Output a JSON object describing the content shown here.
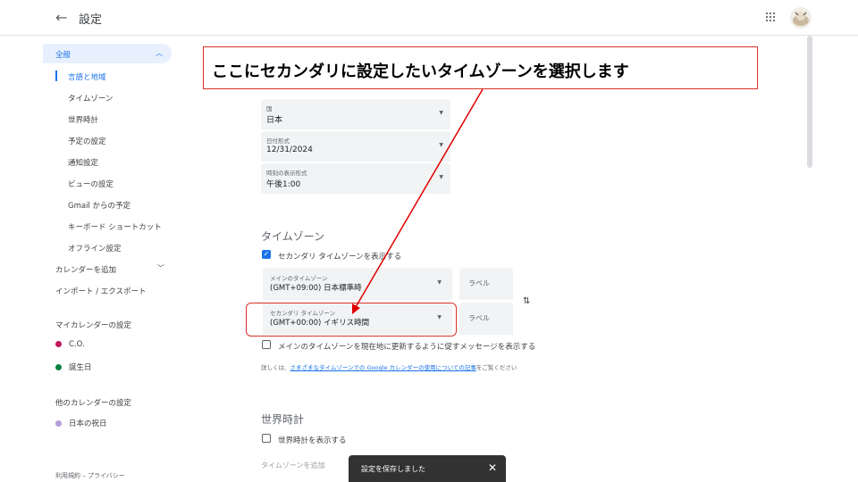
{
  "header": {
    "back_icon": "←",
    "title": "設定"
  },
  "sidebar": {
    "general": {
      "label": "全般",
      "chevron": "^"
    },
    "sub_items": [
      "言語と地域",
      "タイムゾーン",
      "世界時計",
      "予定の設定",
      "通知設定",
      "ビューの設定",
      "Gmail からの予定",
      "キーボード ショートカット",
      "オフライン設定"
    ],
    "add_calendar": "カレンダーを追加",
    "import_export": "インポート / エクスポート",
    "my_calendars_head": "マイカレンダーの設定",
    "my_calendars": [
      {
        "name": "C.O.",
        "color": "#c2185b"
      },
      {
        "name": "誕生日",
        "color": "#0b8043"
      }
    ],
    "other_calendars_head": "他のカレンダーの設定",
    "other_calendars": [
      {
        "name": "日本の祝日",
        "color": "#b39ddb"
      }
    ],
    "footer": "利用規約 – プライバシー"
  },
  "callout": {
    "text": "ここにセカンダリに設定したいタイムゾーンを選択します"
  },
  "language_region": {
    "country": {
      "label": "国",
      "value": "日本"
    },
    "date_format": {
      "label": "日付形式",
      "value": "12/31/2024"
    },
    "time_format": {
      "label": "時刻の表示形式",
      "value": "午後1:00"
    }
  },
  "timezone": {
    "title": "タイムゾーン",
    "secondary_checkbox": "セカンダリ タイムゾーンを表示する",
    "primary": {
      "label": "メインのタイムゾーン",
      "value": "(GMT+09:00) 日本標準時",
      "label_placeholder": "ラベル"
    },
    "secondary": {
      "label": "セカンダリ タイムゾーン",
      "value": "(GMT+00:00) イギリス時間",
      "label_placeholder": "ラベル"
    },
    "update_prompt": "メインのタイムゾーンを現在地に更新するように促すメッセージを表示する",
    "info_prefix": "詳しくは、",
    "info_link": "さまざまなタイムゾーンでの Google カレンダーの使用についての記事",
    "info_suffix": "をご覧ください"
  },
  "world_clock": {
    "title": "世界時計",
    "checkbox": "世界時計を表示する",
    "add_tz": "タイムゾーンを追加"
  },
  "toast": {
    "text": "設定を保存しました",
    "close": "✕"
  }
}
